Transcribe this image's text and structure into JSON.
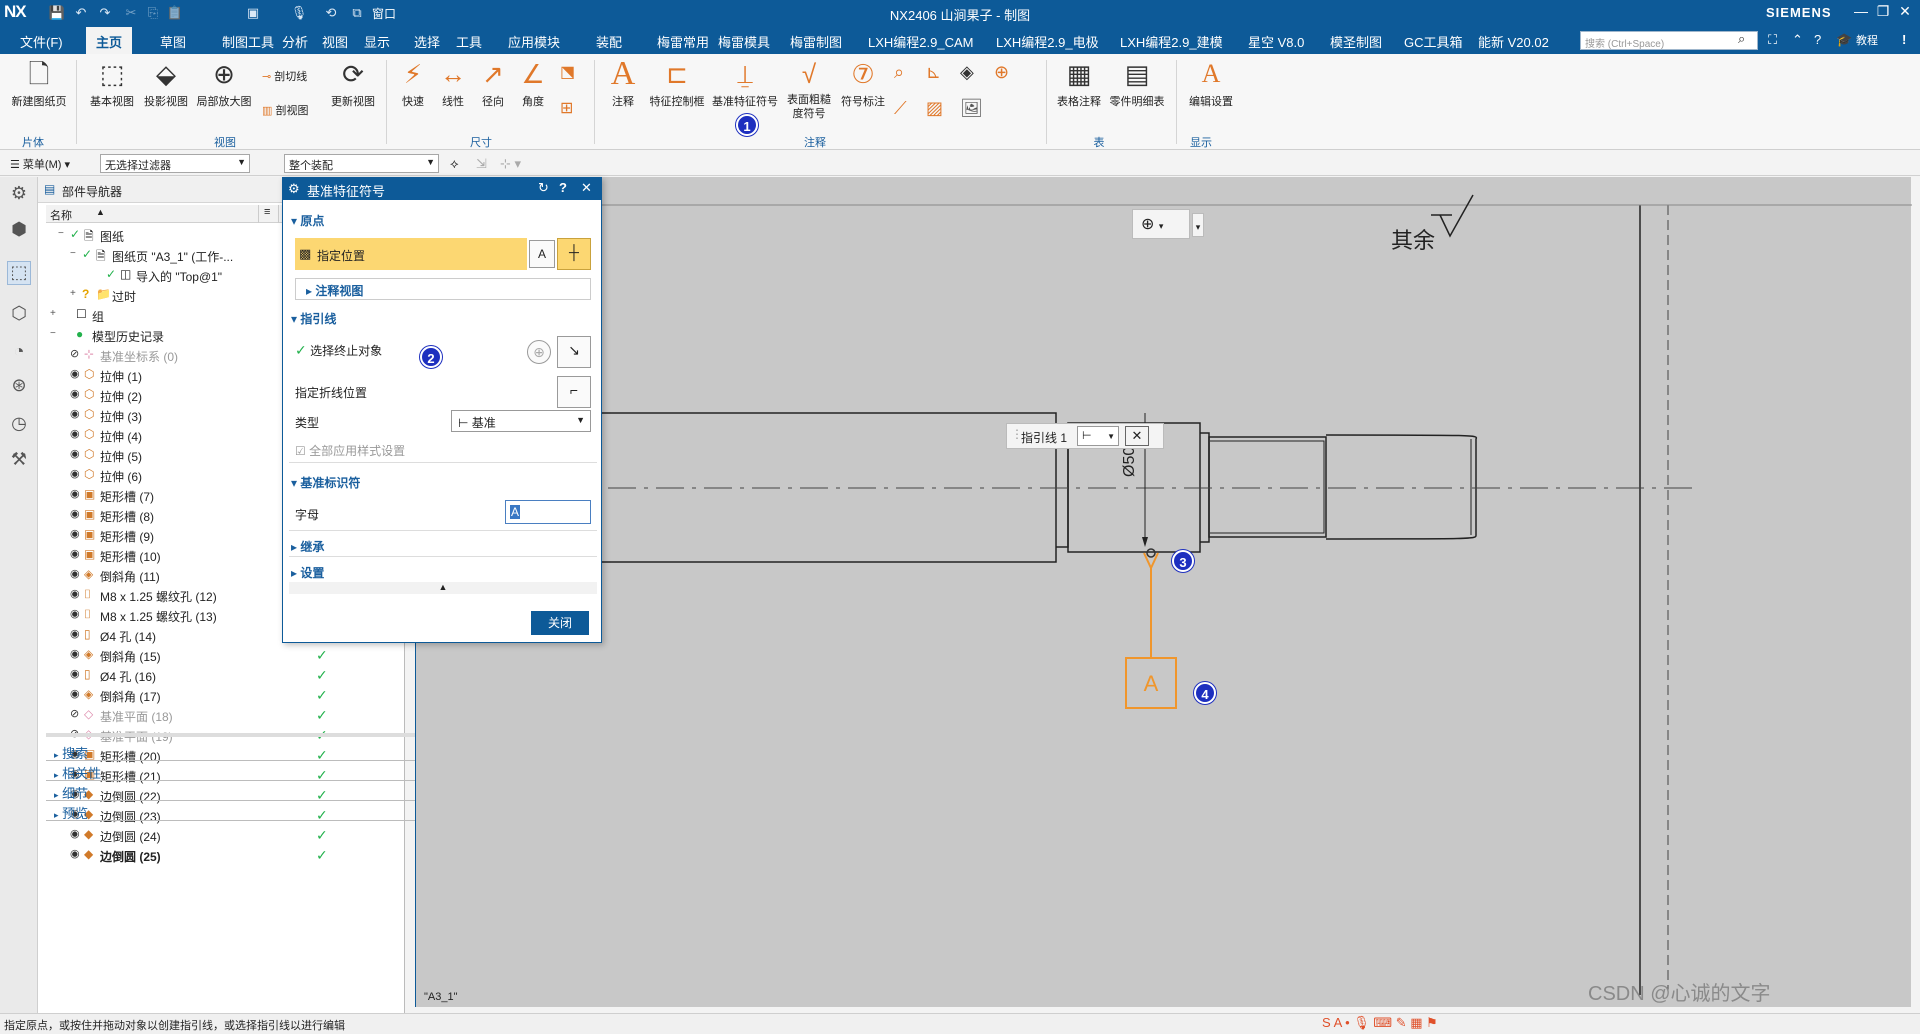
{
  "app": {
    "logo": "NX",
    "window_title": "NX2406 山涧果子 - 制图",
    "brand": "SIEMENS",
    "window_label": "窗口",
    "colors": {
      "titlebar": "#0d5a98",
      "accent": "#1a5f9e",
      "highlight": "#fcd772",
      "orange": "#f0962c",
      "check": "#22b14c"
    }
  },
  "menu": {
    "file": "文件(F)",
    "items": [
      "主页",
      "草图",
      "制图工具",
      "分析",
      "视图",
      "显示",
      "选择",
      "工具",
      "应用模块",
      "装配",
      "梅雷常用",
      "梅雷模具",
      "梅雷制图",
      "LXH编程2.9_CAM",
      "LXH编程2.9_电极",
      "LXH编程2.9_建模",
      "星空 V8.0",
      "模圣制图",
      "GC工具箱",
      "能新 V20.02"
    ],
    "search_placeholder": "搜索 (Ctrl+Space)",
    "help": "教程"
  },
  "ribbon": {
    "new_sheet": "新建图纸页",
    "group_sheet": "片体",
    "base_view": "基本视图",
    "proj_view": "投影视图",
    "detail_view": "局部放大图",
    "section_line": "剖切线",
    "section_view": "剖视图",
    "update_view": "更新视图",
    "group_view": "视图",
    "rapid": "快速",
    "linear": "线性",
    "radial": "径向",
    "angle": "角度",
    "group_dim": "尺寸",
    "note": "注释",
    "feature_frame": "特征控制框",
    "datum_symbol": "基准特征符号",
    "surface_finish": "表面粗糙度符号",
    "id_symbol": "符号标注",
    "group_annot": "注释",
    "table_note": "表格注释",
    "parts_list": "零件明细表",
    "group_table": "表",
    "edit_settings": "编辑设置",
    "group_display": "显示"
  },
  "filterbar": {
    "menu": "菜单(M)",
    "filter": "无选择过滤器",
    "scope": "整个装配"
  },
  "navigator": {
    "title": "部件导航器",
    "col_name": "名称",
    "rows": [
      {
        "exp": "−",
        "label": "图纸",
        "icon": "🗎",
        "indent": 8,
        "check": true
      },
      {
        "exp": "−",
        "label": "图纸页 \"A3_1\" (工作-...",
        "icon": "🗎",
        "indent": 20,
        "check": true
      },
      {
        "exp": "",
        "label": "导入的 \"Top@1\"",
        "icon": "◫",
        "indent": 44,
        "check": true
      },
      {
        "exp": "+",
        "label": "过时",
        "icon": "📁",
        "indent": 20,
        "check": false,
        "q": true
      },
      {
        "exp": "+",
        "label": "组",
        "icon": "☐",
        "indent": 0,
        "check": false
      },
      {
        "exp": "−",
        "label": "模型历史记录",
        "icon": "●",
        "indent": 0,
        "check": false,
        "green": true
      },
      {
        "label": "基准坐标系 (0)",
        "icon": "⊹",
        "gray": true
      },
      {
        "label": "拉伸 (1)",
        "icon": "⬡"
      },
      {
        "label": "拉伸 (2)",
        "icon": "⬡"
      },
      {
        "label": "拉伸 (3)",
        "icon": "⬡"
      },
      {
        "label": "拉伸 (4)",
        "icon": "⬡"
      },
      {
        "label": "拉伸 (5)",
        "icon": "⬡"
      },
      {
        "label": "拉伸 (6)",
        "icon": "⬡"
      },
      {
        "label": "矩形槽 (7)",
        "icon": "▣"
      },
      {
        "label": "矩形槽 (8)",
        "icon": "▣"
      },
      {
        "label": "矩形槽 (9)",
        "icon": "▣"
      },
      {
        "label": "矩形槽 (10)",
        "icon": "▣"
      },
      {
        "label": "倒斜角 (11)",
        "icon": "◈"
      },
      {
        "label": "M8 x 1.25 螺纹孔 (12)",
        "icon": "⌷"
      },
      {
        "label": "M8 x 1.25 螺纹孔 (13)",
        "icon": "⌷"
      },
      {
        "label": "Ø4 孔 (14)",
        "icon": "▯"
      },
      {
        "label": "倒斜角 (15)",
        "icon": "◈",
        "check": true
      },
      {
        "label": "Ø4 孔 (16)",
        "icon": "▯",
        "check": true
      },
      {
        "label": "倒斜角 (17)",
        "icon": "◈",
        "check": true
      },
      {
        "label": "基准平面 (18)",
        "icon": "◇",
        "gray": true,
        "check": true
      },
      {
        "label": "基准平面 (19)",
        "icon": "◇",
        "gray": true,
        "check": true
      },
      {
        "label": "矩形槽 (20)",
        "icon": "▣",
        "check": true
      },
      {
        "label": "矩形槽 (21)",
        "icon": "▣",
        "check": true
      },
      {
        "label": "边倒圆 (22)",
        "icon": "◆",
        "check": true
      },
      {
        "label": "边倒圆 (23)",
        "icon": "◆",
        "check": true
      },
      {
        "label": "边倒圆 (24)",
        "icon": "◆",
        "check": true
      },
      {
        "label": "边倒圆 (25)",
        "icon": "◆",
        "check": true,
        "bold": true
      }
    ],
    "sections": [
      "搜索",
      "相关性",
      "细节",
      "预览"
    ]
  },
  "dialog": {
    "title": "基准特征符号",
    "origin": "原点",
    "specify_location": "指定位置",
    "annot_view": "注释视图",
    "leader": "指引线",
    "select_end": "选择终止对象",
    "specify_jog": "指定折线位置",
    "type_label": "类型",
    "type_value": "基准",
    "apply_all": "全部应用样式设置",
    "datum_id": "基准标识符",
    "letter_label": "字母",
    "letter_value": "A",
    "inherit": "继承",
    "settings": "设置",
    "close": "关闭"
  },
  "canvas": {
    "surface_text": "其余",
    "dim_text": "Ø50",
    "leader_label": "指引线 1",
    "datum_letter": "A",
    "sheet_name": "\"A3_1\""
  },
  "badges": [
    "1",
    "2",
    "3",
    "4"
  ],
  "status": {
    "text": "指定原点，或按住并拖动对象以创建指引线，或选择指引线以进行编辑",
    "watermark": "CSDN @心诚的文字"
  }
}
